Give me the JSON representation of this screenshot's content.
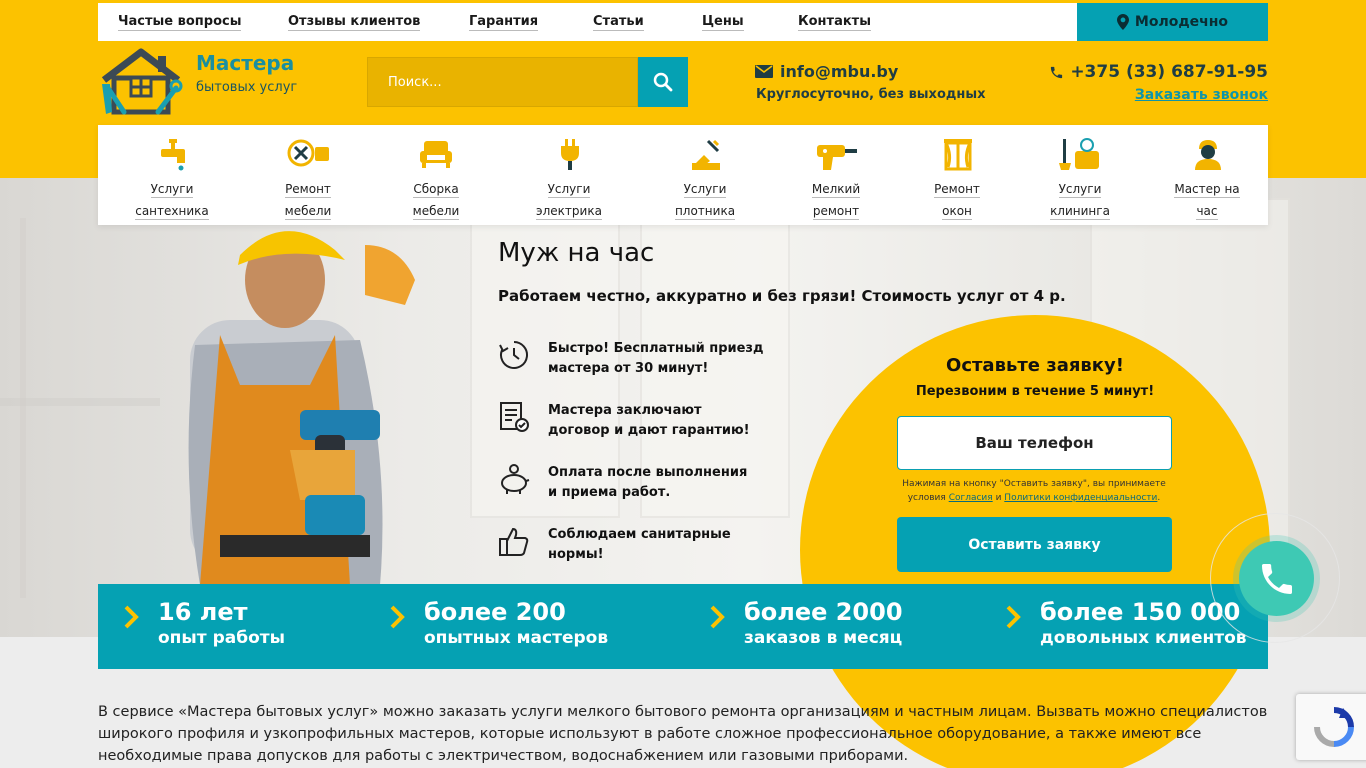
{
  "topnav": {
    "items": [
      "Частые вопросы",
      "Отзывы клиентов",
      "Гарантия",
      "Статьи",
      "Цены",
      "Контакты"
    ],
    "city": "Молодечно"
  },
  "header": {
    "logo_title": "Мастера",
    "logo_subtitle": "бытовых услуг",
    "search_placeholder": "Поиск...",
    "email": "info@mbu.by",
    "hours": "Круглосуточно, без выходных",
    "phone": "+375 (33) 687-91-95",
    "callback": "Заказать звонок"
  },
  "services": [
    {
      "line1": "Услуги",
      "line2": "сантехника",
      "icon": "faucet-icon"
    },
    {
      "line1": "Ремонт",
      "line2": "мебели",
      "icon": "tools-icon"
    },
    {
      "line1": "Сборка",
      "line2": "мебели",
      "icon": "sofa-icon"
    },
    {
      "line1": "Услуги",
      "line2": "электрика",
      "icon": "plug-icon"
    },
    {
      "line1": "Услуги",
      "line2": "плотника",
      "icon": "saw-icon"
    },
    {
      "line1": "Мелкий",
      "line2": "ремонт",
      "icon": "drill-icon"
    },
    {
      "line1": "Ремонт",
      "line2": "окон",
      "icon": "window-icon"
    },
    {
      "line1": "Услуги",
      "line2": "клининга",
      "icon": "cleaning-icon"
    },
    {
      "line1": "Мастер на",
      "line2": "час",
      "icon": "worker-icon"
    }
  ],
  "hero": {
    "title": "Муж на час",
    "subtitle": "Работаем честно, аккуратно и без грязи! Стоимость услуг от 4 р.",
    "features": [
      "Быстро! Бесплатный приезд\nмастера от 30 минут!",
      "Мастера заключают\nдоговор и дают гарантию!",
      "Оплата после выполнения\nи приема работ.",
      "Соблюдаем санитарные\nнормы!"
    ]
  },
  "form": {
    "title": "Оставьте заявку!",
    "subtitle": "Перезвоним в течение 5 минут!",
    "phone_placeholder": "Ваш телефон",
    "consent_prefix": "Нажимая на кнопку \"Оставить заявку\", вы принимаете условия",
    "consent_link1": "Согласия",
    "consent_and": "и",
    "consent_link2": "Политики конфиденциальности",
    "consent_end": ".",
    "submit": "Оставить заявку"
  },
  "stats": [
    {
      "big": "16 лет",
      "small": "опыт работы"
    },
    {
      "big": "более 200",
      "small": "опытных мастеров"
    },
    {
      "big": "более 2000",
      "small": "заказов в месяц"
    },
    {
      "big": "более 150 000",
      "small": "довольных клиентов"
    }
  ],
  "description": "В сервисе «Мастера бытовых услуг» можно заказать услуги мелкого бытового ремонта организациям и частным лицам. Вызвать можно специалистов широкого профиля и узкопрофильных мастеров, которые используют в работе сложное профессиональное оборудование, а также имеют все необходимые права допусков для работы с электричеством, водоснабжением или газовыми приборами.",
  "colors": {
    "brand_yellow": "#fcc200",
    "brand_teal": "#05a1b3",
    "call_green": "#3ec9b4"
  }
}
